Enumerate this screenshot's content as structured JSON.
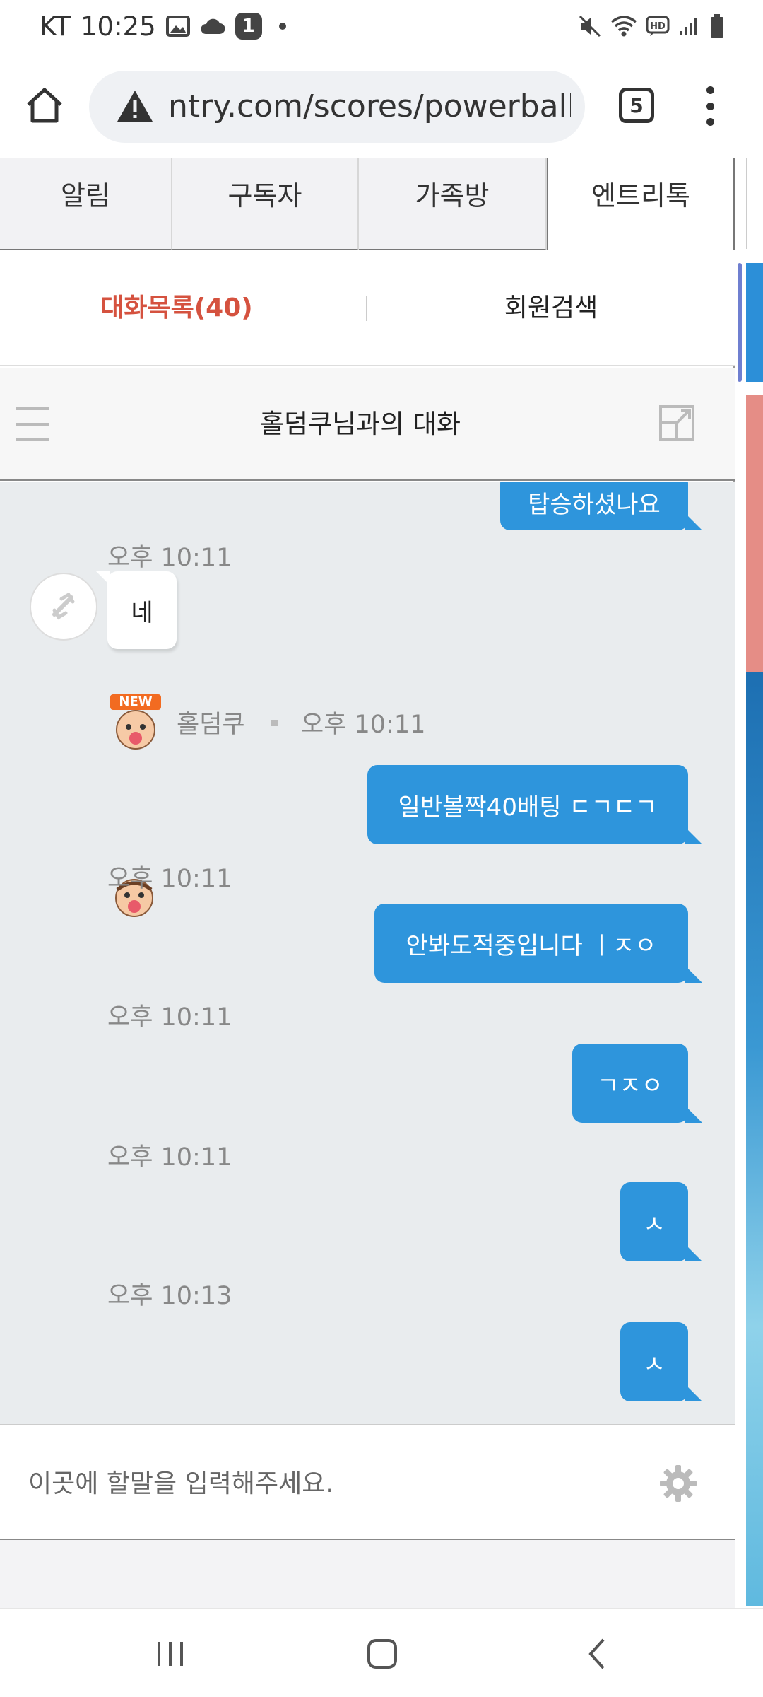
{
  "status_bar": {
    "carrier": "KT",
    "time": "10:25",
    "notification_count": "1"
  },
  "browser": {
    "url": "ntry.com/scores/powerball/",
    "tab_count": "5"
  },
  "top_tabs": [
    {
      "label": "알림",
      "active": false
    },
    {
      "label": "구독자",
      "active": false
    },
    {
      "label": "가족방",
      "active": false
    },
    {
      "label": "엔트리톡",
      "active": true
    }
  ],
  "sub_tabs": {
    "conversation_list": "대화목록(40)",
    "member_search": "회원검색"
  },
  "conversation": {
    "title": "홀덤쿠님과의 대화"
  },
  "messages": {
    "m1": {
      "text": "탑승하셨나요"
    },
    "t1": "오후 10:11",
    "m2": {
      "text": "네"
    },
    "sender": {
      "name": "홀덤쿠",
      "badge": "NEW",
      "time": "오후 10:11"
    },
    "m3": {
      "text": "일반볼짝40배팅 ㄷㄱㄷㄱ"
    },
    "t3": "오후 10:11",
    "m4": {
      "text": "안봐도적중입니다 ㅣㅈㅇ"
    },
    "t4": "오후 10:11",
    "m5": {
      "text": "ㄱㅈㅇ"
    },
    "t5": "오후 10:11",
    "m6": {
      "text": "ㅅ"
    },
    "t6": "오후 10:13",
    "m7": {
      "text": "ㅅ"
    }
  },
  "input": {
    "placeholder": "이곳에 할말을 입력해주세요."
  },
  "colors": {
    "outgoing_bubble": "#2e95dc",
    "active_subtab": "#d5523f",
    "chat_background": "#e9ecee"
  }
}
